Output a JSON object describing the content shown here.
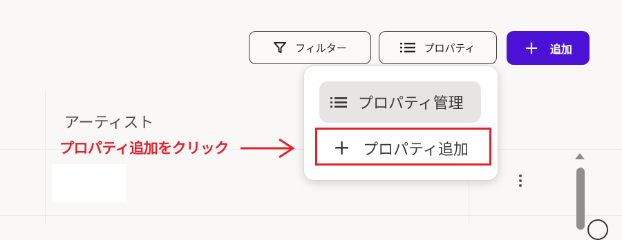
{
  "toolbar": {
    "filter_label": "フィルター",
    "properties_label": "プロパティ",
    "add_label": "追加",
    "add_color": "#4b12d6"
  },
  "table": {
    "column_header": "アーティスト"
  },
  "menu": {
    "manage_label": "プロパティ管理",
    "add_label": "プロパティ追加"
  },
  "annotation": {
    "text": "プロパティ追加をクリック",
    "color": "#e2202a"
  },
  "icons": [
    "filter-icon",
    "list-icon",
    "plus-icon",
    "kebab-icon"
  ]
}
